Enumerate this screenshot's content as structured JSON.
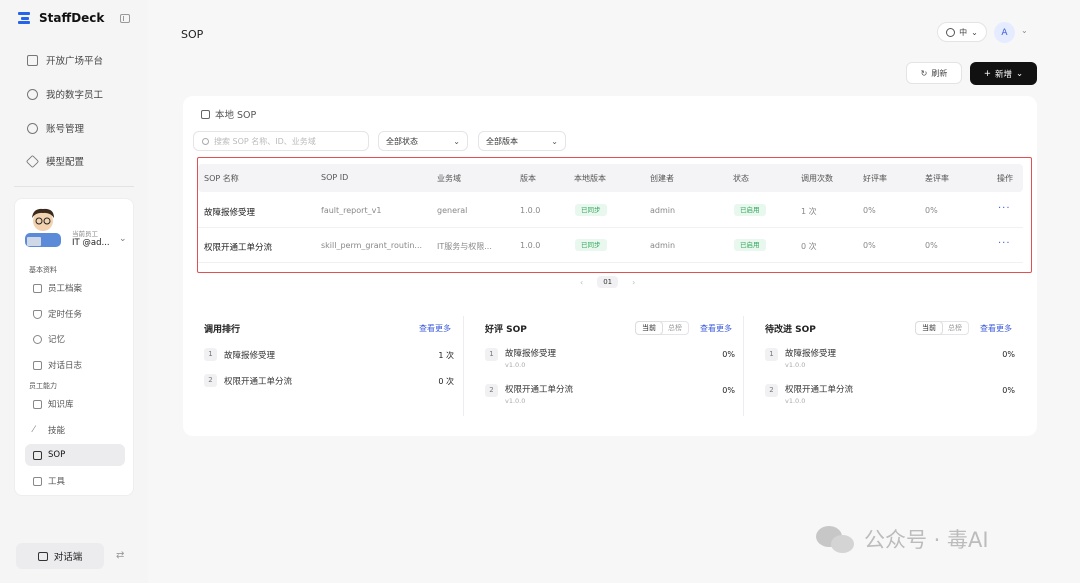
{
  "brand": {
    "name": "StaffDeck"
  },
  "sidebar": {
    "items": [
      {
        "label": "开放广场平台",
        "icon": "building-icon"
      },
      {
        "label": "我的数字员工",
        "icon": "users-icon"
      },
      {
        "label": "账号管理",
        "icon": "user-icon"
      },
      {
        "label": "模型配置",
        "icon": "cube-icon"
      }
    ],
    "user_card": {
      "role_small": "当前员工",
      "role_name": "IT @ad...",
      "group1_title": "基本资料",
      "group1_items": [
        {
          "label": "员工档案",
          "icon": "id-card-icon"
        },
        {
          "label": "定时任务",
          "icon": "shield-clock-icon"
        },
        {
          "label": "记忆",
          "icon": "history-icon"
        },
        {
          "label": "对话日志",
          "icon": "calendar-icon"
        }
      ],
      "group2_title": "员工能力",
      "group2_items": [
        {
          "label": "知识库",
          "icon": "folder-icon"
        },
        {
          "label": "技能",
          "icon": "magic-icon"
        },
        {
          "label": "SOP",
          "icon": "clipboard-icon",
          "active": true
        },
        {
          "label": "工具",
          "icon": "toolbox-icon"
        }
      ]
    },
    "chat_button": "对话端"
  },
  "header": {
    "title": "SOP",
    "lang": "中",
    "avatar": "A",
    "refresh": "刷新",
    "new_button": "新增"
  },
  "panel": {
    "title": "本地 SOP",
    "search_placeholder": "搜索 SOP 名称、ID、业务域",
    "status_filter": "全部状态",
    "version_filter": "全部版本",
    "columns": [
      "SOP 名称",
      "SOP ID",
      "业务域",
      "版本",
      "本地版本",
      "创建者",
      "状态",
      "调用次数",
      "好评率",
      "差评率",
      "操作"
    ],
    "rows": [
      {
        "name": "故障报修受理",
        "id": "fault_report_v1",
        "domain": "general",
        "version": "1.0.0",
        "local": "已同步",
        "creator": "admin",
        "status": "已启用",
        "calls": "1 次",
        "good": "0%",
        "bad": "0%",
        "action": "···"
      },
      {
        "name": "权限开通工单分流",
        "id": "skill_perm_grant_routin...",
        "domain": "IT服务与权限...",
        "version": "1.0.0",
        "local": "已同步",
        "creator": "admin",
        "status": "已启用",
        "calls": "0 次",
        "good": "0%",
        "bad": "0%",
        "action": "···"
      }
    ],
    "page": "01",
    "prev": "‹",
    "next": "›"
  },
  "stats": {
    "ranking": {
      "title": "调用排行",
      "see_more": "查看更多",
      "items": [
        {
          "rank": "1",
          "label": "故障报修受理",
          "value": "1 次"
        },
        {
          "rank": "2",
          "label": "权限开通工单分流",
          "value": "0 次"
        }
      ]
    },
    "good": {
      "title": "好评 SOP",
      "seg_on": "当前",
      "seg_off": "总榜",
      "see_more": "查看更多",
      "items": [
        {
          "rank": "1",
          "label": "故障报修受理",
          "sub": "v1.0.0",
          "value": "0%"
        },
        {
          "rank": "2",
          "label": "权限开通工单分流",
          "sub": "v1.0.0",
          "value": "0%"
        }
      ]
    },
    "bad": {
      "title": "待改进 SOP",
      "seg_on": "当前",
      "seg_off": "总榜",
      "see_more": "查看更多",
      "items": [
        {
          "rank": "1",
          "label": "故障报修受理",
          "sub": "v1.0.0",
          "value": "0%"
        },
        {
          "rank": "2",
          "label": "权限开通工单分流",
          "sub": "v1.0.0",
          "value": "0%"
        }
      ]
    }
  },
  "watermark": {
    "text": "公众号 · 毒AI"
  },
  "colors": {
    "accent": "#3b5bdb",
    "highlight": "#e05252",
    "success": "#32a45a",
    "primary_button": "#111111"
  }
}
